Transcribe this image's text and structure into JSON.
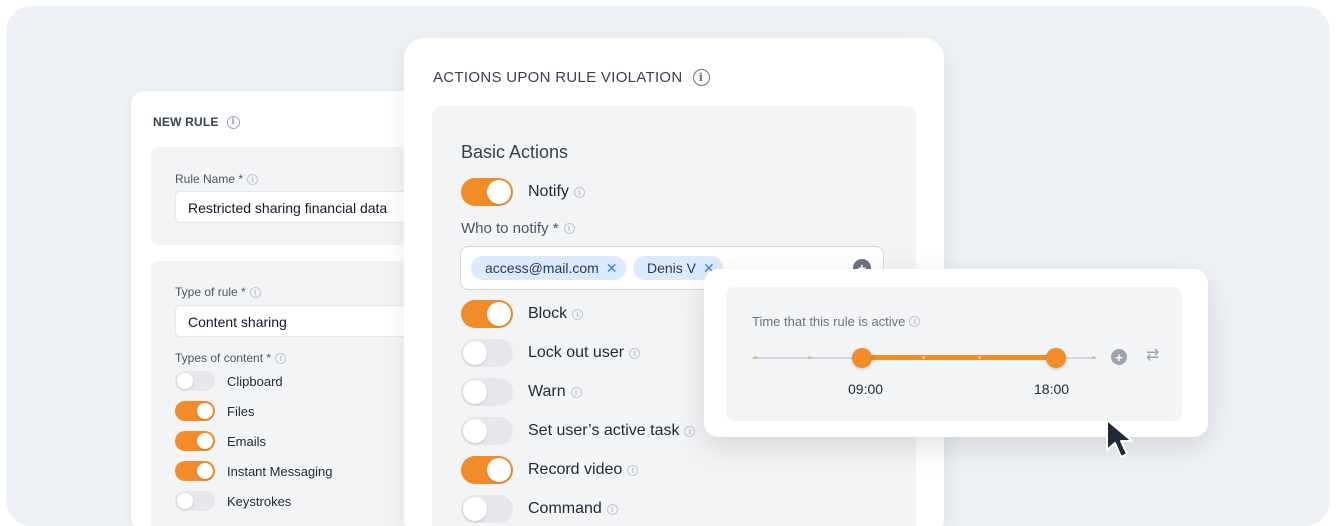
{
  "new_rule": {
    "title": "NEW RULE",
    "rule_name_label": "Rule Name *",
    "rule_name_value": "Restricted sharing financial data",
    "type_label": "Type of rule *",
    "type_value": "Content sharing",
    "content_label": "Types of content *",
    "content_types": [
      {
        "label": "Clipboard",
        "on": false
      },
      {
        "label": "Files",
        "on": true
      },
      {
        "label": "Emails",
        "on": true
      },
      {
        "label": "Instant Messaging",
        "on": true
      },
      {
        "label": "Keystrokes",
        "on": false
      }
    ]
  },
  "actions": {
    "title": "ACTIONS UPON RULE VIOLATION",
    "section_title": "Basic Actions",
    "notify_label": "Notify",
    "notify_on": true,
    "who_label": "Who to notify *",
    "recipients": [
      "access@mail.com",
      "Denis V"
    ],
    "items": [
      {
        "label": "Block",
        "on": true
      },
      {
        "label": "Lock out user",
        "on": false
      },
      {
        "label": "Warn",
        "on": false
      },
      {
        "label": "Set user’s active task",
        "on": false
      },
      {
        "label": "Record video",
        "on": true
      },
      {
        "label": "Command",
        "on": false
      }
    ]
  },
  "time": {
    "label": "Time that this rule is active",
    "start": "09:00",
    "end": "18:00"
  },
  "colors": {
    "accent": "#f28c28",
    "chip_bg": "#dbeafe",
    "background": "#eef1f6"
  },
  "icons": [
    "info-icon",
    "close-icon",
    "plus-circle-icon",
    "swap-icon",
    "cursor-icon"
  ]
}
